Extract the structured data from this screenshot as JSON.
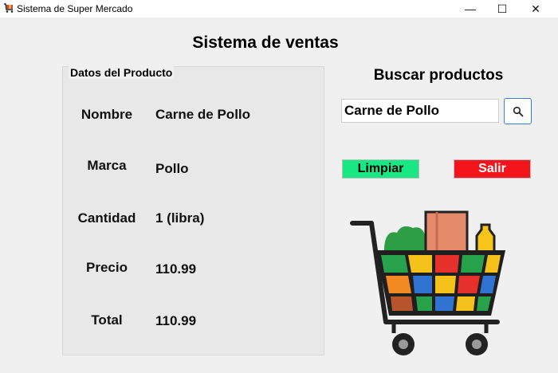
{
  "window": {
    "title": "Sistema de Super Mercado",
    "minimize_glyph": "—",
    "maximize_glyph": "☐",
    "close_glyph": "✕"
  },
  "header": {
    "title": "Sistema de ventas"
  },
  "product_panel": {
    "legend": "Datos del Producto",
    "fields": [
      {
        "label": "Nombre",
        "value": "Carne de Pollo"
      },
      {
        "label": "Marca",
        "value": "Pollo"
      },
      {
        "label": "Cantidad",
        "value": "1 (libra)"
      },
      {
        "label": "Precio",
        "value": "110.99"
      },
      {
        "label": "Total",
        "value": "110.99"
      }
    ]
  },
  "search": {
    "title": "Buscar productos",
    "value": "Carne de Pollo",
    "button_icon": "search-icon"
  },
  "actions": {
    "clear_label": "Limpiar",
    "exit_label": "Salir"
  },
  "colors": {
    "clear_button": "#18e884",
    "exit_button": "#f3141c",
    "search_border": "#3a82c8"
  },
  "illustration": {
    "icon": "shopping-cart-icon"
  }
}
